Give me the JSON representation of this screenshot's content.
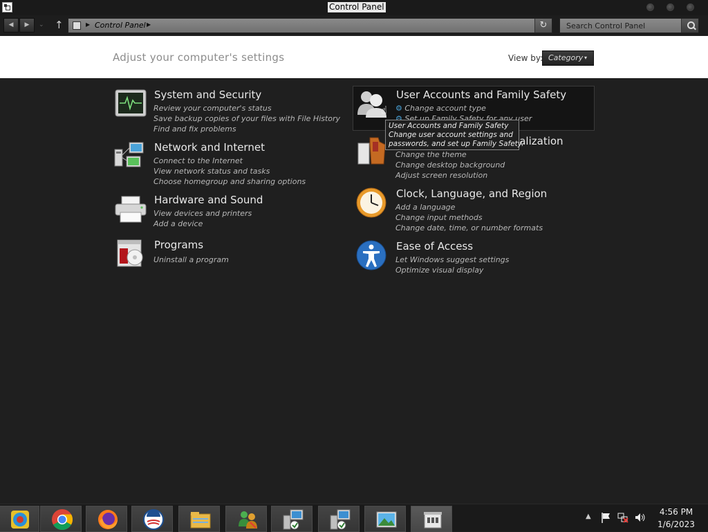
{
  "window": {
    "title": "Control Panel"
  },
  "nav": {
    "back_icon": "arrow-left-icon",
    "forward_icon": "arrow-right-icon",
    "up_icon": "arrow-up-icon",
    "breadcrumb": [
      "Control Panel"
    ],
    "search_placeholder": "Search Control Panel"
  },
  "header": {
    "heading": "Adjust your computer's settings",
    "view_by_label": "View by:",
    "view_by_value": "Category"
  },
  "categories": [
    {
      "title": "System and Security",
      "icon": "system-security-icon",
      "links": [
        "Review your computer's status",
        "Save backup copies of your files with File History",
        "Find and fix problems"
      ]
    },
    {
      "title": "Network and Internet",
      "icon": "network-icon",
      "links": [
        "Connect to the Internet",
        "View network status and tasks",
        "Choose homegroup and sharing options"
      ]
    },
    {
      "title": "Hardware and Sound",
      "icon": "printer-icon",
      "links": [
        "View devices and printers",
        "Add a device"
      ]
    },
    {
      "title": "Programs",
      "icon": "programs-icon",
      "links": [
        "Uninstall a program"
      ]
    },
    {
      "title": "User Accounts and Family Safety",
      "icon": "users-icon",
      "links": [
        "Change account type",
        "Set up Family Safety for any user"
      ]
    },
    {
      "title": "Appearance and Personalization",
      "icon": "appearance-icon",
      "links": [
        "Change the theme",
        "Change desktop background",
        "Adjust screen resolution"
      ]
    },
    {
      "title": "Clock, Language, and Region",
      "icon": "clock-icon",
      "links": [
        "Add a language",
        "Change input methods",
        "Change date, time, or number formats"
      ]
    },
    {
      "title": "Ease of Access",
      "icon": "accessibility-icon",
      "links": [
        "Let Windows suggest settings",
        "Optimize visual display"
      ]
    }
  ],
  "tooltip": {
    "lines": [
      "User Accounts and Family Safety",
      "Change user account settings and",
      "passwords, and set up Family Safety."
    ]
  },
  "taskbar": {
    "items": [
      "control-panel-icon",
      "chrome-icon",
      "firefox-icon",
      "obama-logo-icon",
      "file-explorer-icon",
      "users-network-icon",
      "remote-desktop-icon",
      "remote-desktop-icon",
      "photo-viewer-icon",
      "store-icon"
    ],
    "clock_time": "4:56 PM",
    "clock_date": "1/6/2023"
  }
}
